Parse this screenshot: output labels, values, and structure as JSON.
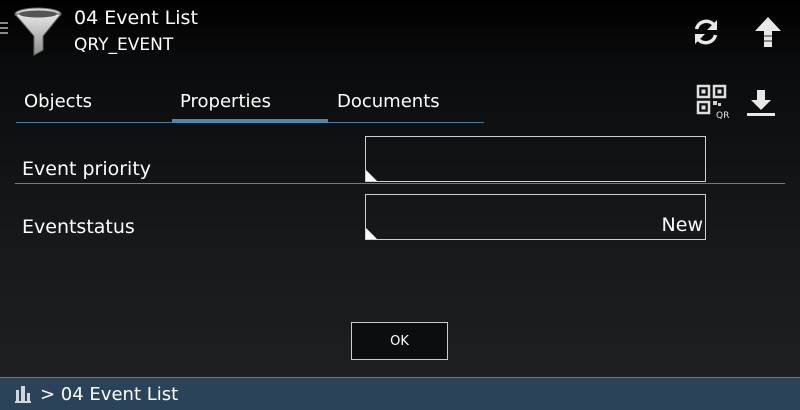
{
  "header": {
    "title": "04 Event List",
    "subtitle": "QRY_EVENT",
    "icons": [
      "menu-icon",
      "filter-icon",
      "refresh-icon",
      "upload-arrow-icon"
    ]
  },
  "tabs": [
    {
      "label": "Objects",
      "active": false
    },
    {
      "label": "Properties",
      "active": true
    },
    {
      "label": "Documents",
      "active": false
    }
  ],
  "toolbar": {
    "icons": [
      "qr-code-icon",
      "download-icon"
    ],
    "qr_text": "QR"
  },
  "form": {
    "fields": [
      {
        "label": "Event priority",
        "value": ""
      },
      {
        "label": "Eventstatus",
        "value": "New"
      }
    ]
  },
  "ok_label": "OK",
  "footer": {
    "breadcrumb": "> 04 Event List",
    "icon": "castle-icon"
  },
  "colors": {
    "accent": "#4e86ad",
    "footer_bg": "#2b4358",
    "background": "#1a1c1e"
  }
}
